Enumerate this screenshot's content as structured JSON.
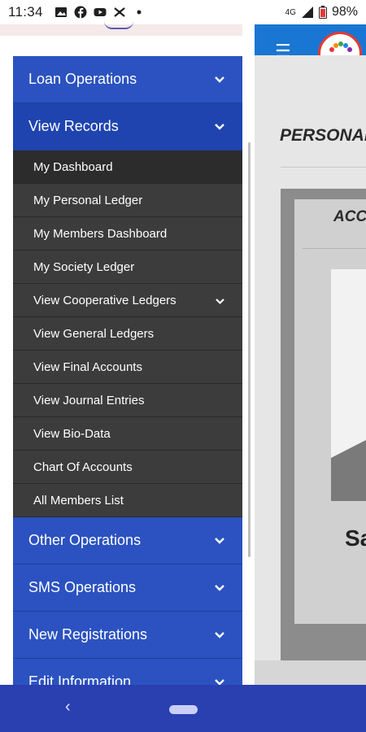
{
  "status_bar": {
    "time": "11:34",
    "notification_icons": [
      "image-icon",
      "facebook-icon",
      "youtube-icon",
      "cooperative-app-icon",
      "dot-icon"
    ],
    "network": "4G",
    "battery": "98%"
  },
  "app_bar": {
    "menu_icon": "hamburger-icon",
    "logo": "society-logo"
  },
  "background_page": {
    "title": "PERSONAL",
    "card_title": "ACC",
    "card_text": "Sa"
  },
  "drawer": {
    "menu": [
      {
        "label": "Loan Operations",
        "icon": "chevron-down-icon",
        "expanded": false
      },
      {
        "label": "View Records",
        "icon": "chevron-down-icon",
        "expanded": true,
        "children": [
          {
            "label": "My Dashboard",
            "current": true
          },
          {
            "label": "My Personal Ledger"
          },
          {
            "label": "My Members Dashboard"
          },
          {
            "label": "My Society Ledger"
          },
          {
            "label": "View Cooperative Ledgers",
            "has_submenu": true
          },
          {
            "label": "View General Ledgers"
          },
          {
            "label": "View Final Accounts"
          },
          {
            "label": "View Journal Entries"
          },
          {
            "label": "View Bio-Data"
          },
          {
            "label": "Chart Of Accounts"
          },
          {
            "label": "All Members List"
          }
        ]
      },
      {
        "label": "Other Operations",
        "icon": "chevron-down-icon",
        "expanded": false
      },
      {
        "label": "SMS Operations",
        "icon": "chevron-down-icon",
        "expanded": false
      },
      {
        "label": "New Registrations",
        "icon": "chevron-down-icon",
        "expanded": false
      },
      {
        "label": "Edit Information",
        "icon": "chevron-down-icon",
        "expanded": false
      }
    ]
  },
  "nav_bar": {
    "back_icon": "back-icon",
    "home_icon": "home-pill-icon"
  },
  "colors": {
    "menu_blue": "#2b52c0",
    "submenu_gray": "#3c3c3c",
    "app_bar_blue": "#1976d2",
    "nav_bar_blue": "#2a3fb0"
  }
}
